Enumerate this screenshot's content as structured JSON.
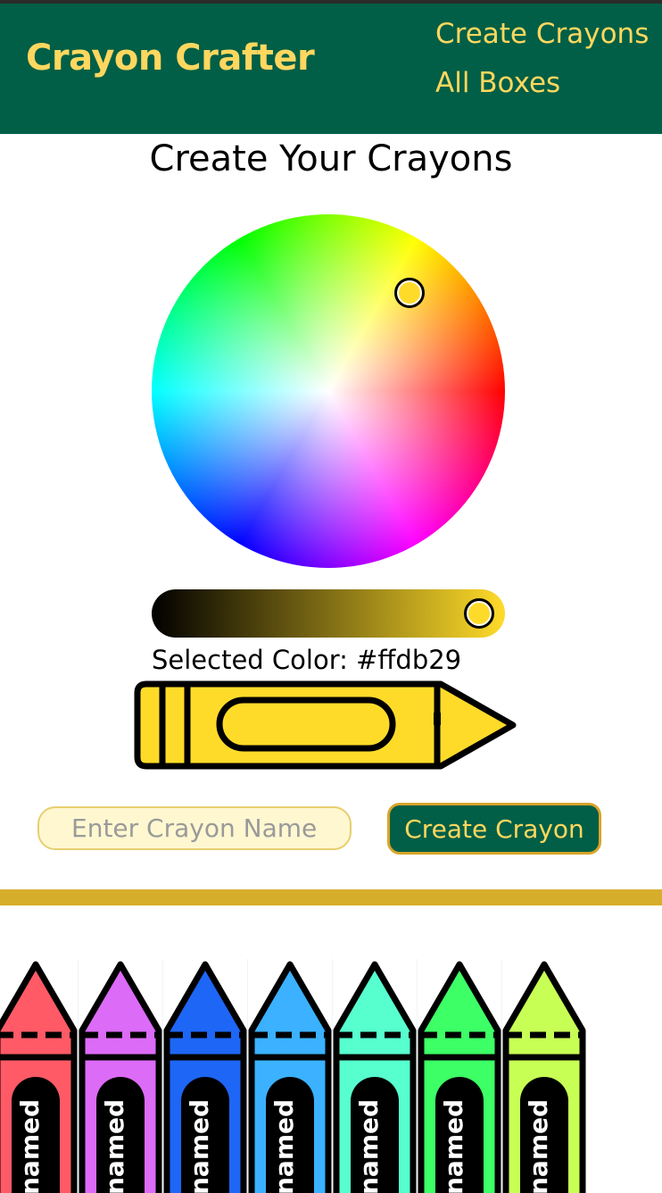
{
  "app": {
    "brand": "Crayon Crafter"
  },
  "nav": {
    "links": [
      "Create Crayons",
      "All Boxes"
    ]
  },
  "page": {
    "title": "Create Your Crayons"
  },
  "picker": {
    "selected_label": "Selected Color: #ffdb29",
    "selected_hex": "#ffdb29",
    "brightness": 1.0
  },
  "form": {
    "name_value": "",
    "name_placeholder": "Enter Crayon Name",
    "create_label": "Create Crayon"
  },
  "colors": {
    "header_bg": "#005f46",
    "accent": "#ffd75f",
    "divider": "#d7ae2b"
  },
  "crayons": [
    {
      "color": "#ff5a66",
      "name": "named"
    },
    {
      "color": "#dc6bf7",
      "name": "named"
    },
    {
      "color": "#1e66f5",
      "name": "named"
    },
    {
      "color": "#3bb1ff",
      "name": "named"
    },
    {
      "color": "#57ffcf",
      "name": "named"
    },
    {
      "color": "#3dff66",
      "name": "named"
    },
    {
      "color": "#c8ff55",
      "name": "named"
    }
  ]
}
